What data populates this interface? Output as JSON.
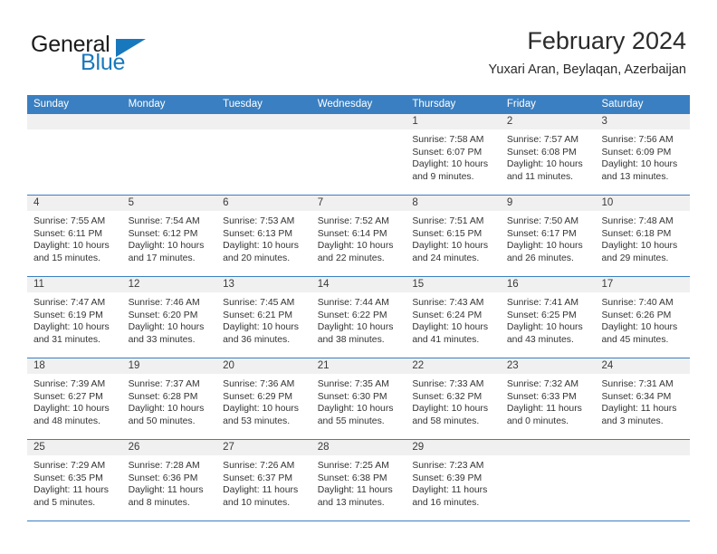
{
  "brand": {
    "word_one": "General",
    "word_two": "Blue",
    "triangle_icon": "triangle-icon"
  },
  "header": {
    "title": "February 2024",
    "subtitle": "Yuxari Aran, Beylaqan, Azerbaijan"
  },
  "colors": {
    "header_blue": "#3a7fc1",
    "brand_blue": "#1878bd",
    "day_head_gray": "#f0f0f0",
    "text": "#333333"
  },
  "calendar": {
    "weekdays": [
      "Sunday",
      "Monday",
      "Tuesday",
      "Wednesday",
      "Thursday",
      "Friday",
      "Saturday"
    ],
    "weeks": [
      [
        {
          "day": "",
          "empty": true
        },
        {
          "day": "",
          "empty": true
        },
        {
          "day": "",
          "empty": true
        },
        {
          "day": "",
          "empty": true
        },
        {
          "day": "1",
          "sunrise": "Sunrise: 7:58 AM",
          "sunset": "Sunset: 6:07 PM",
          "daylight": "Daylight: 10 hours and 9 minutes."
        },
        {
          "day": "2",
          "sunrise": "Sunrise: 7:57 AM",
          "sunset": "Sunset: 6:08 PM",
          "daylight": "Daylight: 10 hours and 11 minutes."
        },
        {
          "day": "3",
          "sunrise": "Sunrise: 7:56 AM",
          "sunset": "Sunset: 6:09 PM",
          "daylight": "Daylight: 10 hours and 13 minutes."
        }
      ],
      [
        {
          "day": "4",
          "sunrise": "Sunrise: 7:55 AM",
          "sunset": "Sunset: 6:11 PM",
          "daylight": "Daylight: 10 hours and 15 minutes."
        },
        {
          "day": "5",
          "sunrise": "Sunrise: 7:54 AM",
          "sunset": "Sunset: 6:12 PM",
          "daylight": "Daylight: 10 hours and 17 minutes."
        },
        {
          "day": "6",
          "sunrise": "Sunrise: 7:53 AM",
          "sunset": "Sunset: 6:13 PM",
          "daylight": "Daylight: 10 hours and 20 minutes."
        },
        {
          "day": "7",
          "sunrise": "Sunrise: 7:52 AM",
          "sunset": "Sunset: 6:14 PM",
          "daylight": "Daylight: 10 hours and 22 minutes."
        },
        {
          "day": "8",
          "sunrise": "Sunrise: 7:51 AM",
          "sunset": "Sunset: 6:15 PM",
          "daylight": "Daylight: 10 hours and 24 minutes."
        },
        {
          "day": "9",
          "sunrise": "Sunrise: 7:50 AM",
          "sunset": "Sunset: 6:17 PM",
          "daylight": "Daylight: 10 hours and 26 minutes."
        },
        {
          "day": "10",
          "sunrise": "Sunrise: 7:48 AM",
          "sunset": "Sunset: 6:18 PM",
          "daylight": "Daylight: 10 hours and 29 minutes."
        }
      ],
      [
        {
          "day": "11",
          "sunrise": "Sunrise: 7:47 AM",
          "sunset": "Sunset: 6:19 PM",
          "daylight": "Daylight: 10 hours and 31 minutes."
        },
        {
          "day": "12",
          "sunrise": "Sunrise: 7:46 AM",
          "sunset": "Sunset: 6:20 PM",
          "daylight": "Daylight: 10 hours and 33 minutes."
        },
        {
          "day": "13",
          "sunrise": "Sunrise: 7:45 AM",
          "sunset": "Sunset: 6:21 PM",
          "daylight": "Daylight: 10 hours and 36 minutes."
        },
        {
          "day": "14",
          "sunrise": "Sunrise: 7:44 AM",
          "sunset": "Sunset: 6:22 PM",
          "daylight": "Daylight: 10 hours and 38 minutes."
        },
        {
          "day": "15",
          "sunrise": "Sunrise: 7:43 AM",
          "sunset": "Sunset: 6:24 PM",
          "daylight": "Daylight: 10 hours and 41 minutes."
        },
        {
          "day": "16",
          "sunrise": "Sunrise: 7:41 AM",
          "sunset": "Sunset: 6:25 PM",
          "daylight": "Daylight: 10 hours and 43 minutes."
        },
        {
          "day": "17",
          "sunrise": "Sunrise: 7:40 AM",
          "sunset": "Sunset: 6:26 PM",
          "daylight": "Daylight: 10 hours and 45 minutes."
        }
      ],
      [
        {
          "day": "18",
          "sunrise": "Sunrise: 7:39 AM",
          "sunset": "Sunset: 6:27 PM",
          "daylight": "Daylight: 10 hours and 48 minutes."
        },
        {
          "day": "19",
          "sunrise": "Sunrise: 7:37 AM",
          "sunset": "Sunset: 6:28 PM",
          "daylight": "Daylight: 10 hours and 50 minutes."
        },
        {
          "day": "20",
          "sunrise": "Sunrise: 7:36 AM",
          "sunset": "Sunset: 6:29 PM",
          "daylight": "Daylight: 10 hours and 53 minutes."
        },
        {
          "day": "21",
          "sunrise": "Sunrise: 7:35 AM",
          "sunset": "Sunset: 6:30 PM",
          "daylight": "Daylight: 10 hours and 55 minutes."
        },
        {
          "day": "22",
          "sunrise": "Sunrise: 7:33 AM",
          "sunset": "Sunset: 6:32 PM",
          "daylight": "Daylight: 10 hours and 58 minutes."
        },
        {
          "day": "23",
          "sunrise": "Sunrise: 7:32 AM",
          "sunset": "Sunset: 6:33 PM",
          "daylight": "Daylight: 11 hours and 0 minutes."
        },
        {
          "day": "24",
          "sunrise": "Sunrise: 7:31 AM",
          "sunset": "Sunset: 6:34 PM",
          "daylight": "Daylight: 11 hours and 3 minutes."
        }
      ],
      [
        {
          "day": "25",
          "sunrise": "Sunrise: 7:29 AM",
          "sunset": "Sunset: 6:35 PM",
          "daylight": "Daylight: 11 hours and 5 minutes."
        },
        {
          "day": "26",
          "sunrise": "Sunrise: 7:28 AM",
          "sunset": "Sunset: 6:36 PM",
          "daylight": "Daylight: 11 hours and 8 minutes."
        },
        {
          "day": "27",
          "sunrise": "Sunrise: 7:26 AM",
          "sunset": "Sunset: 6:37 PM",
          "daylight": "Daylight: 11 hours and 10 minutes."
        },
        {
          "day": "28",
          "sunrise": "Sunrise: 7:25 AM",
          "sunset": "Sunset: 6:38 PM",
          "daylight": "Daylight: 11 hours and 13 minutes."
        },
        {
          "day": "29",
          "sunrise": "Sunrise: 7:23 AM",
          "sunset": "Sunset: 6:39 PM",
          "daylight": "Daylight: 11 hours and 16 minutes."
        },
        {
          "day": "",
          "empty": true
        },
        {
          "day": "",
          "empty": true
        }
      ]
    ]
  }
}
